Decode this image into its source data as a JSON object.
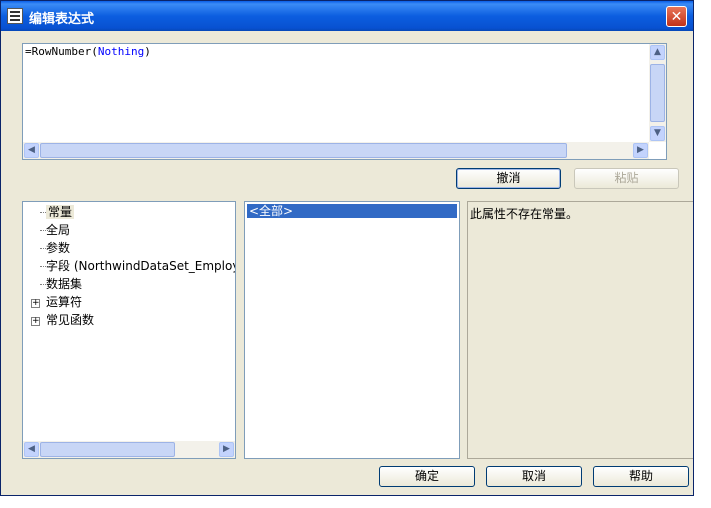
{
  "window": {
    "title": "编辑表达式",
    "close_glyph": "✕"
  },
  "editor": {
    "prefix": "=RowNumber(",
    "keyword": "Nothing",
    "suffix": ")"
  },
  "buttons": {
    "undo": "撤消",
    "paste": "粘贴",
    "ok": "确定",
    "cancel": "取消",
    "help": "帮助"
  },
  "tree": {
    "items": [
      {
        "label": "常量",
        "selected": true
      },
      {
        "label": "全局"
      },
      {
        "label": "参数"
      },
      {
        "label": "字段 (NorthwindDataSet_Employee"
      },
      {
        "label": "数据集"
      },
      {
        "label": "运算符",
        "expandable": true,
        "expander": "+"
      },
      {
        "label": "常见函数",
        "expandable": true,
        "expander": "+"
      }
    ]
  },
  "list": {
    "items": [
      "<全部>"
    ]
  },
  "description": "此属性不存在常量。",
  "scroll_arrows": {
    "left": "◀",
    "right": "▶",
    "up": "▲",
    "down": "▼"
  }
}
